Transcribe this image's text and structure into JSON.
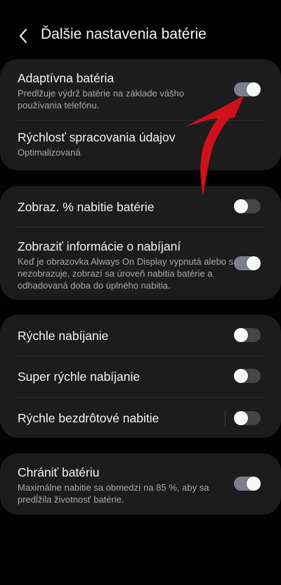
{
  "header": {
    "title": "Ďalšie nastavenia batérie"
  },
  "group1": {
    "adaptive": {
      "label": "Adaptívna batéria",
      "desc": "Predlžuje výdrž batérie na základe vášho používania telefónu.",
      "on": true
    },
    "processing": {
      "label": "Rýchlosť spracovania údajov",
      "value": "Optimalizovaná"
    }
  },
  "group2": {
    "percent": {
      "label": "Zobraz. % nabitie batérie",
      "on": false
    },
    "charging_info": {
      "label": "Zobraziť informácie o nabíjaní",
      "desc": "Keď je obrazovka Always On Display vypnutá alebo sa nezobrazuje, zobrazí sa úroveň nabitia batérie a odhadovaná doba do úplného nabitia.",
      "on": true
    }
  },
  "group3": {
    "fast": {
      "label": "Rýchle nabíjanie",
      "on": false
    },
    "super_fast": {
      "label": "Super rýchle nabíjanie",
      "on": false
    },
    "wireless": {
      "label": "Rýchle bezdrôtové nabitie",
      "on": false
    }
  },
  "group4": {
    "protect": {
      "label": "Chrániť batériu",
      "desc": "Maximálne nabitie sa obmedzí na 85 %, aby sa predĺžila životnosť batérie.",
      "on": true
    }
  },
  "colors": {
    "background": "#020202",
    "card": "#1c1c1c",
    "toggle_on": "#7c7f87",
    "toggle_off": "#454545",
    "annotation_arrow": "#d0101a"
  }
}
